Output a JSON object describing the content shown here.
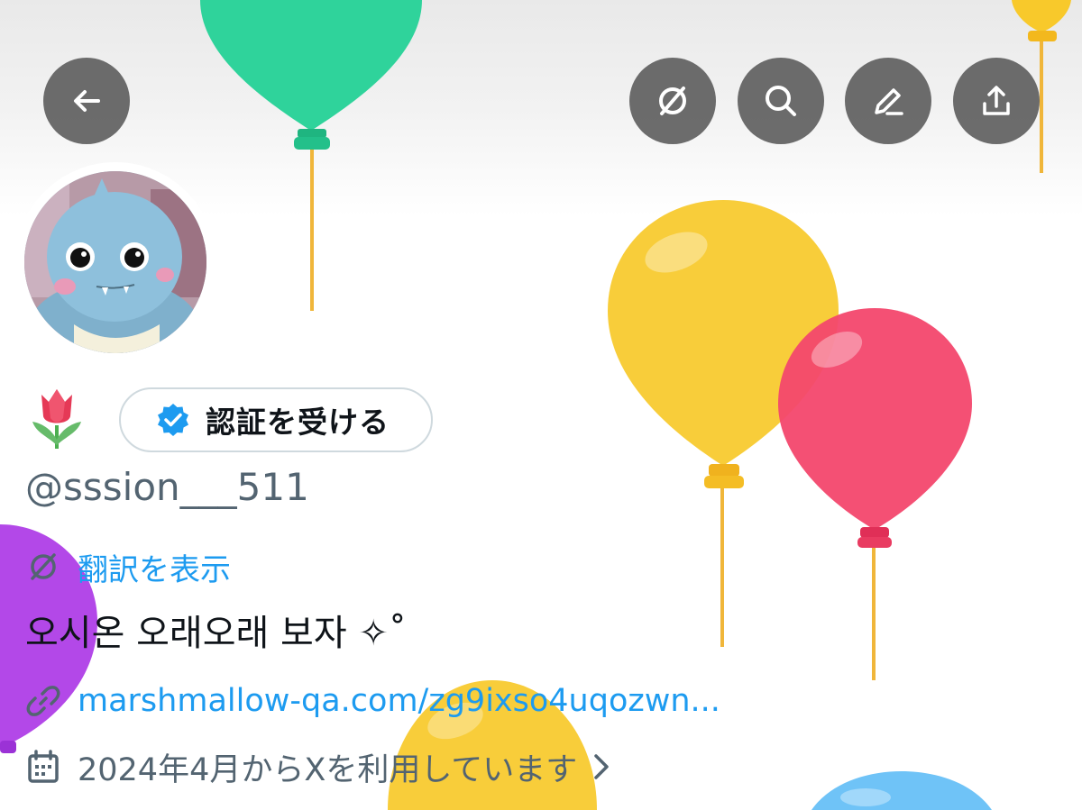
{
  "header": {
    "back_icon": "arrow-left-icon",
    "actions": [
      "hide-translation-icon",
      "search-icon",
      "edit-icon",
      "share-icon"
    ]
  },
  "profile": {
    "emoji": "🌷",
    "verify_button_label": "認証を受ける",
    "handle": "@sssion___511",
    "translate_link": "翻訳を表示",
    "bio": "오시온 오래오래 보자 ✧˚",
    "website": "marshmallow-qa.com/zg9ixso4uqozwn...",
    "joined": "2024年4月からXを利用しています"
  },
  "colors": {
    "accent": "#1d9bf0",
    "text_primary": "#0f1419",
    "text_secondary": "#536471",
    "button_overlay": "#606060"
  }
}
